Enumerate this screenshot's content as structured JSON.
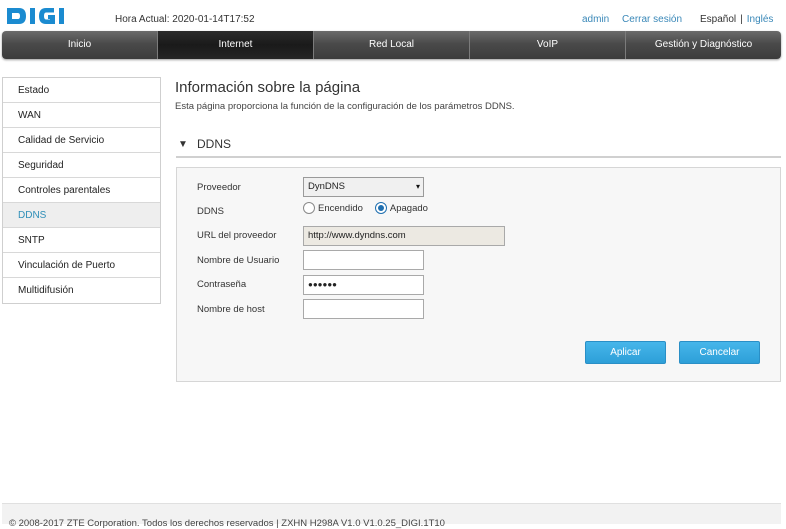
{
  "header": {
    "logo_text": "DIGI",
    "time_label": "Hora Actual: 2020-01-14T17:52",
    "user_link": "admin",
    "logout_link": "Cerrar sesión",
    "lang_active": "Español",
    "lang_separator": "|",
    "lang_other": "Inglés"
  },
  "nav": {
    "tabs": [
      {
        "label": "Inicio"
      },
      {
        "label": "Internet"
      },
      {
        "label": "Red Local"
      },
      {
        "label": "VoIP"
      },
      {
        "label": "Gestión y Diagnóstico"
      }
    ],
    "active": "Internet"
  },
  "sidebar": {
    "items": [
      {
        "label": "Estado"
      },
      {
        "label": "WAN"
      },
      {
        "label": "Calidad de Servicio"
      },
      {
        "label": "Seguridad"
      },
      {
        "label": "Controles parentales"
      },
      {
        "label": "DDNS"
      },
      {
        "label": "SNTP"
      },
      {
        "label": "Vinculación de Puerto"
      },
      {
        "label": "Multidifusión"
      }
    ],
    "active": "DDNS"
  },
  "main": {
    "title": "Información sobre la página",
    "description": "Esta página proporciona la función de la configuración de los parámetros DDNS.",
    "section_title": "DDNS",
    "section_arrow": "▼"
  },
  "form": {
    "provider_label": "Proveedor",
    "provider_value": "DynDNS",
    "ddns_label": "DDNS",
    "ddns_on_label": "Encendido",
    "ddns_off_label": "Apagado",
    "ddns_selected": "Apagado",
    "url_label": "URL del proveedor",
    "url_value": "http://www.dyndns.com",
    "username_label": "Nombre de Usuario",
    "username_value": "",
    "password_label": "Contraseña",
    "password_value": "●●●●●●",
    "hostname_label": "Nombre de host",
    "hostname_value": "",
    "apply_label": "Aplicar",
    "cancel_label": "Cancelar"
  },
  "footer": {
    "text": "© 2008-2017 ZTE Corporation. Todos los derechos reservados  |   ZXHN H298A V1.0 V1.0.25_DIGI.1T10"
  },
  "colors": {
    "accent": "#2f8fb8",
    "button": "#3aaae0",
    "nav_bg": "#4a4a4a",
    "nav_active": "#1f1f1f",
    "logo": "#1b8bd0"
  }
}
